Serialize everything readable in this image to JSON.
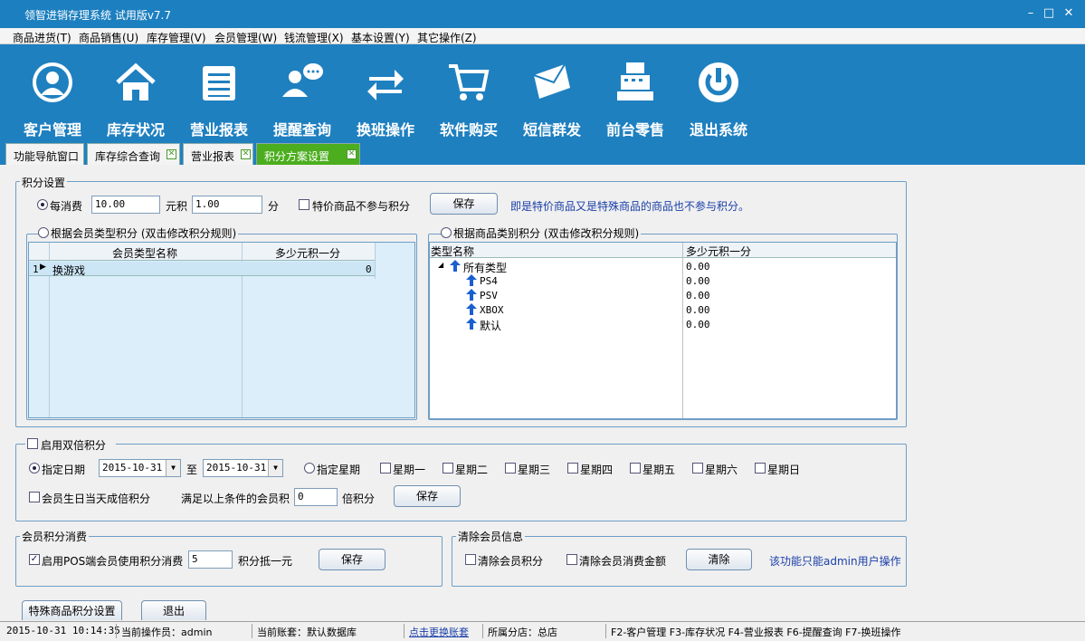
{
  "app": {
    "title": "领智进销存理系统 试用版v7.7"
  },
  "window_controls": {
    "minimize": "–",
    "maximize": "□",
    "close": "✕"
  },
  "menu": [
    "商品进货(T)",
    "商品销售(U)",
    "库存管理(V)",
    "会员管理(W)",
    "钱流管理(X)",
    "基本设置(Y)",
    "其它操作(Z)"
  ],
  "toolbar": [
    {
      "label": "客户管理",
      "icon": "customer-icon"
    },
    {
      "label": "库存状况",
      "icon": "warehouse-icon"
    },
    {
      "label": "营业报表",
      "icon": "report-icon"
    },
    {
      "label": "提醒查询",
      "icon": "reminder-icon"
    },
    {
      "label": "换班操作",
      "icon": "shift-icon"
    },
    {
      "label": "软件购买",
      "icon": "cart-icon"
    },
    {
      "label": "短信群发",
      "icon": "sms-icon"
    },
    {
      "label": "前台零售",
      "icon": "cashier-icon"
    },
    {
      "label": "退出系统",
      "icon": "power-icon"
    }
  ],
  "tabs": [
    {
      "label": "功能导航窗口",
      "closable": false
    },
    {
      "label": "库存综合查询",
      "closable": true
    },
    {
      "label": "营业报表",
      "closable": true
    },
    {
      "label": "积分方案设置",
      "closable": true,
      "active": true
    }
  ],
  "points": {
    "group_title": "积分设置",
    "per_spend_label": "每消费",
    "spend_value": "10.00",
    "yuan_points_label": "元积",
    "points_value": "1.00",
    "fen_label": "分",
    "special_excluded_label": "特价商品不参与积分",
    "save_label": "保存",
    "note": "即是特价商品又是特殊商品的商品也不参与积分。",
    "member_type_title": "根据会员类型积分 (双击修改积分规则)",
    "member_grid": {
      "headers": [
        "会员类型名称",
        "多少元积一分"
      ],
      "rows": [
        {
          "index": "1",
          "name": "换游戏",
          "value": "0"
        }
      ]
    },
    "category_title": "根据商品类别积分 (双击修改积分规则)",
    "category_grid": {
      "headers": [
        "类型名称",
        "多少元积一分"
      ],
      "rows": [
        {
          "name": "所有类型",
          "value": "0.00"
        },
        {
          "name": "PS4",
          "value": "0.00"
        },
        {
          "name": "PSV",
          "value": "0.00"
        },
        {
          "name": "XBOX",
          "value": "0.00"
        },
        {
          "name": "默认",
          "value": "0.00"
        }
      ]
    }
  },
  "double": {
    "title": "启用双倍积分",
    "specify_date_label": "指定日期",
    "date_from": "2015-10-31",
    "to_label": "至",
    "date_to": "2015-10-31",
    "specify_week_label": "指定星期",
    "weekdays": [
      "星期一",
      "星期二",
      "星期三",
      "星期四",
      "星期五",
      "星期六",
      "星期日"
    ],
    "birthday_label": "会员生日当天成倍积分",
    "multiplier_label": "满足以上条件的会员积",
    "multiplier_value": "0",
    "times_label": "倍积分",
    "save_label": "保存"
  },
  "redeem": {
    "title": "会员积分消费",
    "enable_label": "启用POS端会员使用积分消费",
    "value": "5",
    "suffix": "积分抵一元",
    "save_label": "保存"
  },
  "clear": {
    "title": "清除会员信息",
    "clear_points_label": "清除会员积分",
    "clear_amount_label": "清除会员消费金额",
    "clear_button": "清除",
    "note": "该功能只能admin用户操作"
  },
  "bottom_buttons": {
    "special": "特殊商品积分设置",
    "exit": "退出"
  },
  "status": {
    "datetime": "2015-10-31 10:14:35",
    "operator": "当前操作员：admin",
    "account": "当前账套：默认数据库",
    "switch_link": "点击更换账套",
    "branch": "所属分店：总店",
    "shortcuts": "F2-客户管理 F3-库存状况 F4-营业报表 F6-提醒查询 F7-换班操作"
  }
}
